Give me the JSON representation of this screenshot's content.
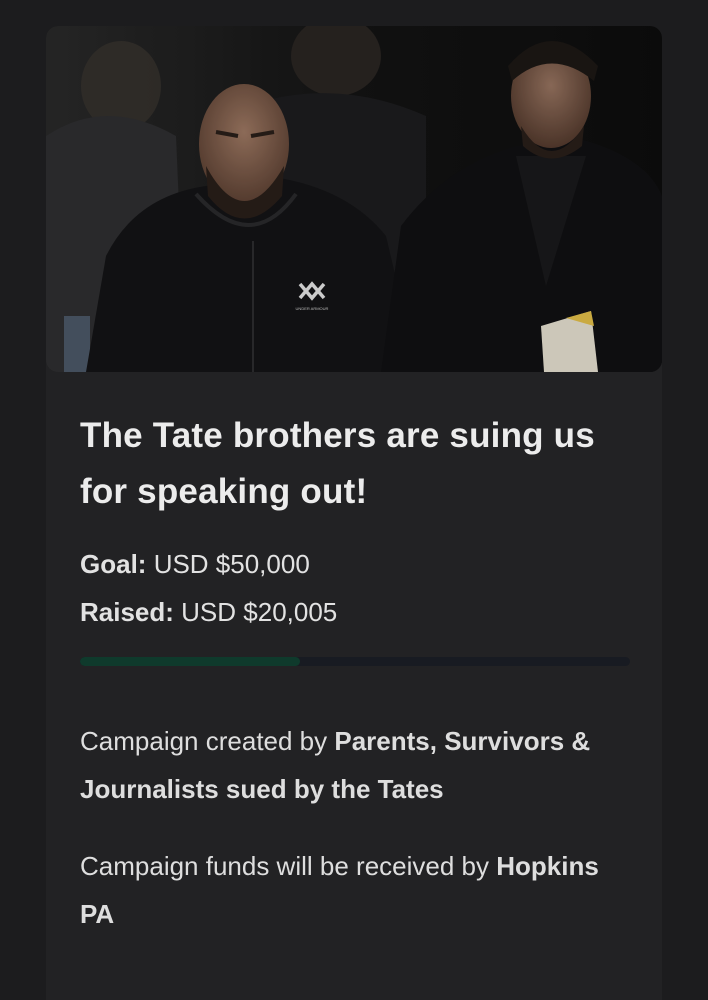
{
  "campaign": {
    "title": "The Tate brothers are suing us for speaking out!",
    "goal_label": "Goal:",
    "goal_value": "USD $50,000",
    "raised_label": "Raised:",
    "raised_value": "USD $20,005",
    "progress_fraction": 0.4,
    "creator_prefix": "Campaign created by ",
    "creator_name": "Parents, Survivors & Journalists sued by the Tates",
    "funds_prefix": "Campaign funds will be received by ",
    "funds_recipient": "Hopkins PA",
    "hero_logo_text": "UNDER ARMOUR"
  },
  "colors": {
    "background": "#1c1c1e",
    "card": "#222224",
    "progress_track": "#181b22",
    "progress_fill": "#0f3a2c"
  }
}
